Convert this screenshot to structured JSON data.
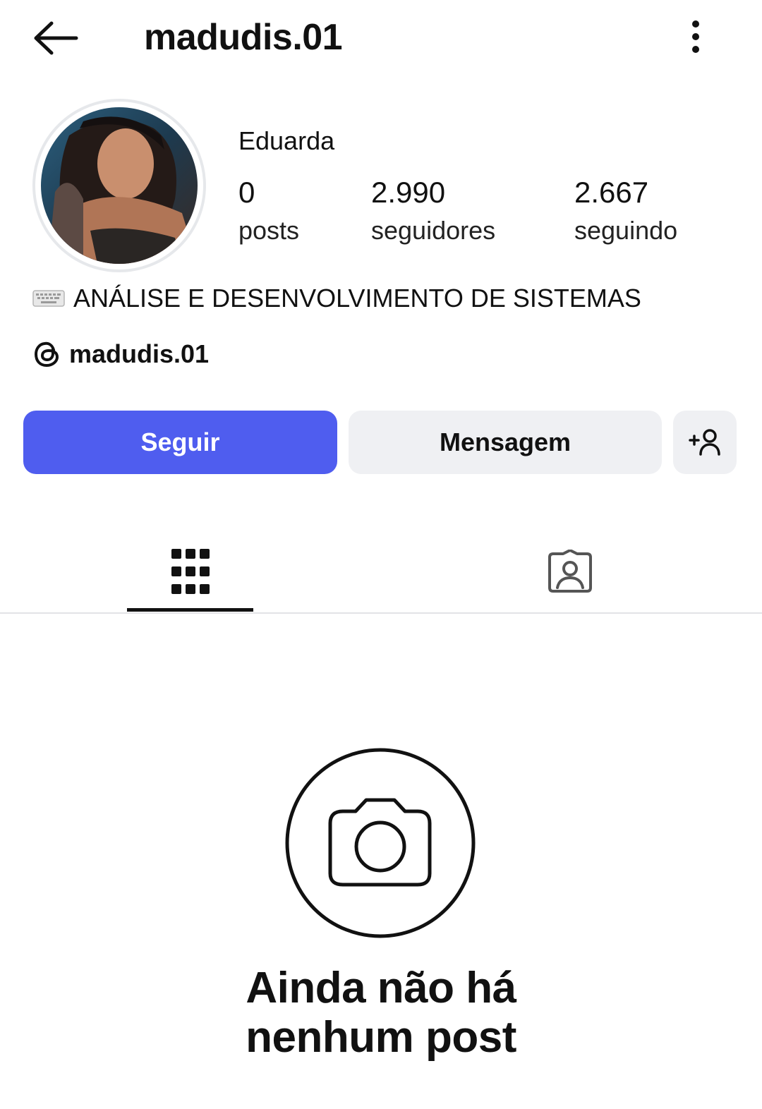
{
  "header": {
    "username": "madudis.01",
    "back_icon": "arrow-left-icon",
    "more_icon": "more-vertical-icon"
  },
  "profile": {
    "display_name": "Eduarda",
    "stats": [
      {
        "value": "0",
        "label": "posts"
      },
      {
        "value": "2.990",
        "label": "seguidores"
      },
      {
        "value": "2.667",
        "label": "seguindo"
      }
    ],
    "bio": "ANÁLISE E DESENVOLVIMENTO DE SISTEMAS",
    "bio_icon": "keyboard-icon",
    "threads_handle": "madudis.01",
    "threads_icon": "threads-icon"
  },
  "actions": {
    "follow_label": "Seguir",
    "message_label": "Mensagem",
    "suggest_icon": "add-person-icon"
  },
  "tabs": [
    {
      "name": "posts-grid",
      "icon": "grid-icon",
      "active": true
    },
    {
      "name": "tagged",
      "icon": "tagged-person-icon",
      "active": false
    }
  ],
  "empty_state": {
    "icon": "camera-icon",
    "title_line1": "Ainda não há",
    "title_line2": "nenhum post"
  },
  "colors": {
    "accent": "#4f5def",
    "secondary_button": "#eff0f3",
    "text": "#111111"
  }
}
